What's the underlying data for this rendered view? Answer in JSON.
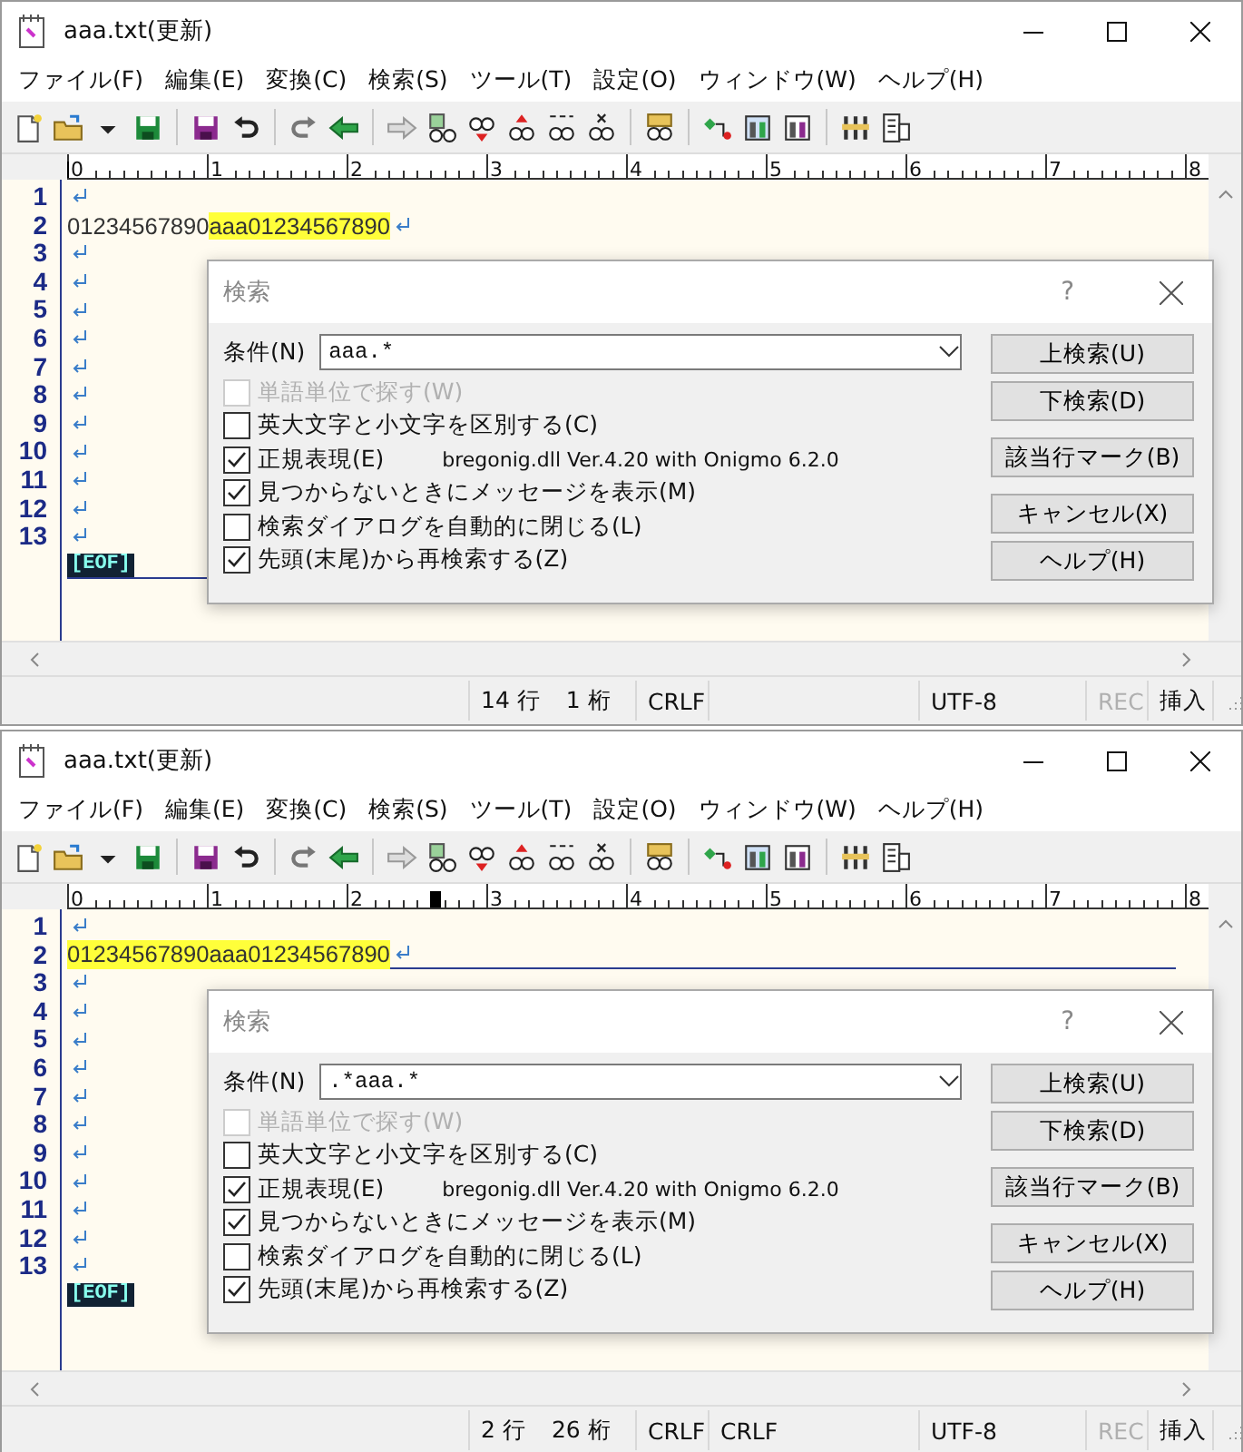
{
  "windows": [
    {
      "title": "aaa.txt(更新)",
      "menu": [
        "ファイル(F)",
        "編集(E)",
        "変換(C)",
        "検索(S)",
        "ツール(T)",
        "設定(O)",
        "ウィンドウ(W)",
        "ヘルプ(H)"
      ],
      "ruler": {
        "labels": [
          "0",
          "1",
          "2",
          "3",
          "4",
          "5",
          "6",
          "7",
          "8"
        ],
        "level": 0
      },
      "lines": [
        {
          "number": "1",
          "cursor": false
        },
        {
          "number": "2",
          "cursor": false,
          "segments": [
            {
              "text": "01234567890",
              "highlighted": false
            },
            {
              "text": "aaa01234567890",
              "highlighted": true
            }
          ]
        },
        {
          "number": "3",
          "cursor": false
        },
        {
          "number": "4",
          "cursor": false
        },
        {
          "number": "5",
          "cursor": false
        },
        {
          "number": "6",
          "cursor": false
        },
        {
          "number": "7",
          "cursor": false
        },
        {
          "number": "8",
          "cursor": false
        },
        {
          "number": "9",
          "cursor": false
        },
        {
          "number": "10",
          "cursor": false
        },
        {
          "number": "11",
          "cursor": false
        },
        {
          "number": "12",
          "cursor": false
        },
        {
          "number": "13",
          "cursor": false
        }
      ],
      "eof": {
        "text": "[EOF]",
        "cursor": true
      },
      "dialog": {
        "title": "検索",
        "help": "?",
        "condition_label": "条件(N)",
        "condition_value": "aaa.*",
        "options": [
          {
            "label": "単語単位で探す(W)",
            "checked": false,
            "disabled": true
          },
          {
            "label": "英大文字と小文字を区別する(C)",
            "checked": false,
            "disabled": false
          },
          {
            "label": "正規表現(E)",
            "checked": true,
            "disabled": false,
            "note": "bregonig.dll Ver.4.20 with Onigmo 6.2.0"
          },
          {
            "label": "見つからないときにメッセージを表示(M)",
            "checked": true,
            "disabled": false
          },
          {
            "label": "検索ダイアログを自動的に閉じる(L)",
            "checked": false,
            "disabled": false
          },
          {
            "label": "先頭(末尾)から再検索する(Z)",
            "checked": true,
            "disabled": false
          }
        ],
        "buttons": [
          "上検索(U)",
          "下検索(D)",
          "該当行マーク(B)",
          "キャンセル(X)",
          "ヘルプ(H)"
        ]
      },
      "status": {
        "row": "14 行",
        "column": "1 桁",
        "eol": "CRLF",
        "encoding": "UTF-8",
        "rec": {
          "text": "REC",
          "disabled": true
        },
        "mode": "挿入"
      }
    },
    {
      "title": "aaa.txt(更新)",
      "menu": [
        "ファイル(F)",
        "編集(E)",
        "変換(C)",
        "検索(S)",
        "ツール(T)",
        "設定(O)",
        "ウィンドウ(W)",
        "ヘルプ(H)"
      ],
      "ruler": {
        "labels": [
          "0",
          "1",
          "2",
          "3",
          "4",
          "5",
          "6",
          "7",
          "8"
        ],
        "level": 0.325
      },
      "lines": [
        {
          "number": "1",
          "cursor": false
        },
        {
          "number": "2",
          "cursor": true,
          "segments": [
            {
              "text": "01234567890aaa01234567890",
              "highlighted": true
            }
          ]
        },
        {
          "number": "3",
          "cursor": false
        },
        {
          "number": "4",
          "cursor": false
        },
        {
          "number": "5",
          "cursor": false
        },
        {
          "number": "6",
          "cursor": false
        },
        {
          "number": "7",
          "cursor": false
        },
        {
          "number": "8",
          "cursor": false
        },
        {
          "number": "9",
          "cursor": false
        },
        {
          "number": "10",
          "cursor": false
        },
        {
          "number": "11",
          "cursor": false
        },
        {
          "number": "12",
          "cursor": false
        },
        {
          "number": "13",
          "cursor": false
        }
      ],
      "eof": {
        "text": "[EOF]",
        "cursor": false
      },
      "dialog": {
        "title": "検索",
        "help": "?",
        "condition_label": "条件(N)",
        "condition_value": ".*aaa.*",
        "options": [
          {
            "label": "単語単位で探す(W)",
            "checked": false,
            "disabled": true
          },
          {
            "label": "英大文字と小文字を区別する(C)",
            "checked": false,
            "disabled": false
          },
          {
            "label": "正規表現(E)",
            "checked": true,
            "disabled": false,
            "note": "bregonig.dll Ver.4.20 with Onigmo 6.2.0"
          },
          {
            "label": "見つからないときにメッセージを表示(M)",
            "checked": true,
            "disabled": false
          },
          {
            "label": "検索ダイアログを自動的に閉じる(L)",
            "checked": false,
            "disabled": false
          },
          {
            "label": "先頭(末尾)から再検索する(Z)",
            "checked": true,
            "disabled": false
          }
        ],
        "buttons": [
          "上検索(U)",
          "下検索(D)",
          "該当行マーク(B)",
          "キャンセル(X)",
          "ヘルプ(H)"
        ]
      },
      "status": {
        "row": "2 行",
        "column": "26 桁",
        "eol": "CRLF",
        "eol2": "CRLF",
        "encoding": "UTF-8",
        "rec": {
          "text": "REC",
          "disabled": true
        },
        "mode": "挿入"
      }
    }
  ]
}
